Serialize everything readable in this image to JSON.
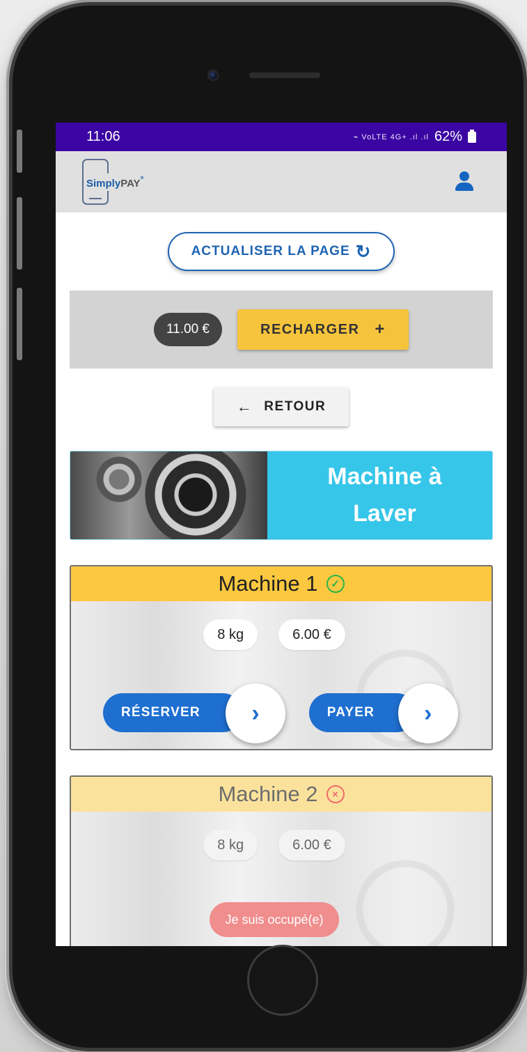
{
  "status_bar": {
    "time": "11:06",
    "indicators": "⌁ VoLTE 4G+ .ıl .ıl",
    "battery_percent": "62%"
  },
  "app_bar": {
    "logo_brand": "Simply",
    "logo_brand_suffix": "PAY",
    "logo_mark": "°",
    "icon": "user-icon"
  },
  "refresh": {
    "label": "ACTUALISER LA PAGE",
    "icon": "↻"
  },
  "wallet": {
    "balance": "11.00 €",
    "recharge_label": "RECHARGER",
    "recharge_icon": "+"
  },
  "back": {
    "label": "RETOUR",
    "icon": "←"
  },
  "category": {
    "title_line1": "Machine à",
    "title_line2": "Laver",
    "color": "#36c6e9"
  },
  "machines": [
    {
      "name": "Machine 1",
      "status": "available",
      "status_glyph": "✓",
      "capacity": "8 kg",
      "price": "6.00 €",
      "reserve_label": "RÉSERVER",
      "pay_label": "PAYER",
      "chevron": "›"
    },
    {
      "name": "Machine 2",
      "status": "busy",
      "status_glyph": "×",
      "capacity": "8 kg",
      "price": "6.00 €",
      "busy_label": "Je suis occupé(e)"
    }
  ],
  "colors": {
    "status_bar": "#3b05a3",
    "primary": "#1e6fd0",
    "accent_yellow": "#fcc840",
    "available": "#2db34a",
    "busy": "#f06c6c"
  }
}
